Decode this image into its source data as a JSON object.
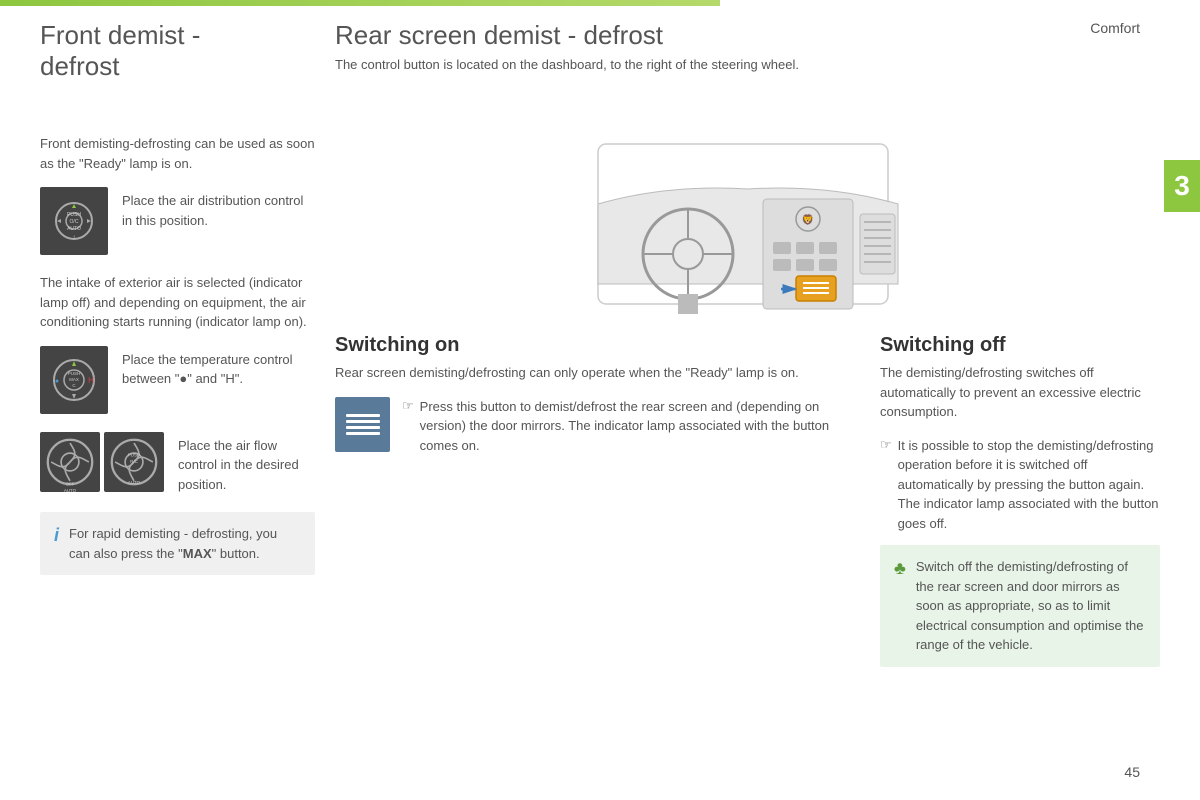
{
  "header": {
    "comfort_label": "Comfort",
    "top_bar_width": 720,
    "chapter_number": "3",
    "page_number": "45"
  },
  "left_section": {
    "title_line1": "Front demist -",
    "title_line2": "defrost",
    "intro_text": "Front demisting-defrosting can be used as soon as the \"Ready\" lamp is on.",
    "instruction1": {
      "text": "Place the air distribution control in this position."
    },
    "body_text": "The intake of exterior air is selected (indicator lamp off) and depending on equipment, the air conditioning starts running (indicator lamp on).",
    "instruction2": {
      "text": "Place the temperature control between \"●\" and \"H\"."
    },
    "instruction3": {
      "text": "Place the air flow control in the desired position."
    },
    "info_box": {
      "icon": "i",
      "text_part1": "For rapid demisting - defrosting, you can also press the \"",
      "bold_text": "MAX",
      "text_part2": "\" button."
    }
  },
  "right_section": {
    "title": "Rear screen demist - defrost",
    "subtitle": "The control button is located on the dashboard, to the right of the steering wheel.",
    "switching_on": {
      "title": "Switching on",
      "intro": "Rear screen demisting/defrosting can only operate when the \"Ready\" lamp is on.",
      "bullet_phone_char": "☞",
      "bullet_text": "Press this button to demist/defrost the rear screen and (depending on version) the door mirrors. The indicator lamp associated with the button comes on."
    },
    "switching_off": {
      "title": "Switching off",
      "intro": "The demisting/defrosting switches off automatically to prevent an excessive electric consumption.",
      "bullet_phone_char": "☞",
      "bullet_text": "It is possible to stop the demisting/defrosting operation before it is switched off automatically by pressing the button again. The indicator lamp associated with the button goes off."
    },
    "tip_box": {
      "icon": "♣",
      "text": "Switch off the demisting/defrosting of the rear screen and door mirrors as soon as appropriate, so as to limit electrical consumption and optimise the range of the vehicle."
    }
  }
}
